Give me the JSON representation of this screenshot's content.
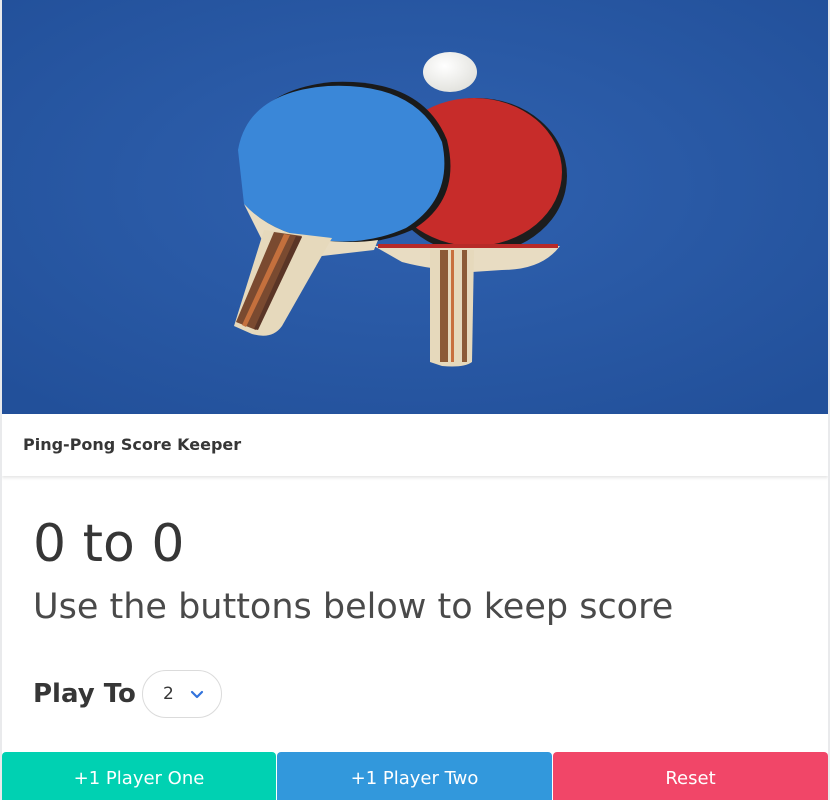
{
  "header": {
    "title": "Ping-Pong Score Keeper"
  },
  "hero": {
    "image": "ping-pong-paddles-photo"
  },
  "scoreboard": {
    "score_text": "0 to 0",
    "subtitle": "Use the buttons below to keep score"
  },
  "settings": {
    "play_to_label": "Play To",
    "play_to_value": "2",
    "chevron_icon": "chevron-down-icon"
  },
  "buttons": {
    "player_one": {
      "label": "+1 Player One",
      "color": "#00d1b2"
    },
    "player_two": {
      "label": "+1 Player Two",
      "color": "#3298dc"
    },
    "reset": {
      "label": "Reset",
      "color": "#f14668"
    }
  },
  "colors": {
    "hero_background": "#2a5aa6",
    "select_chevron": "#3273dc"
  }
}
